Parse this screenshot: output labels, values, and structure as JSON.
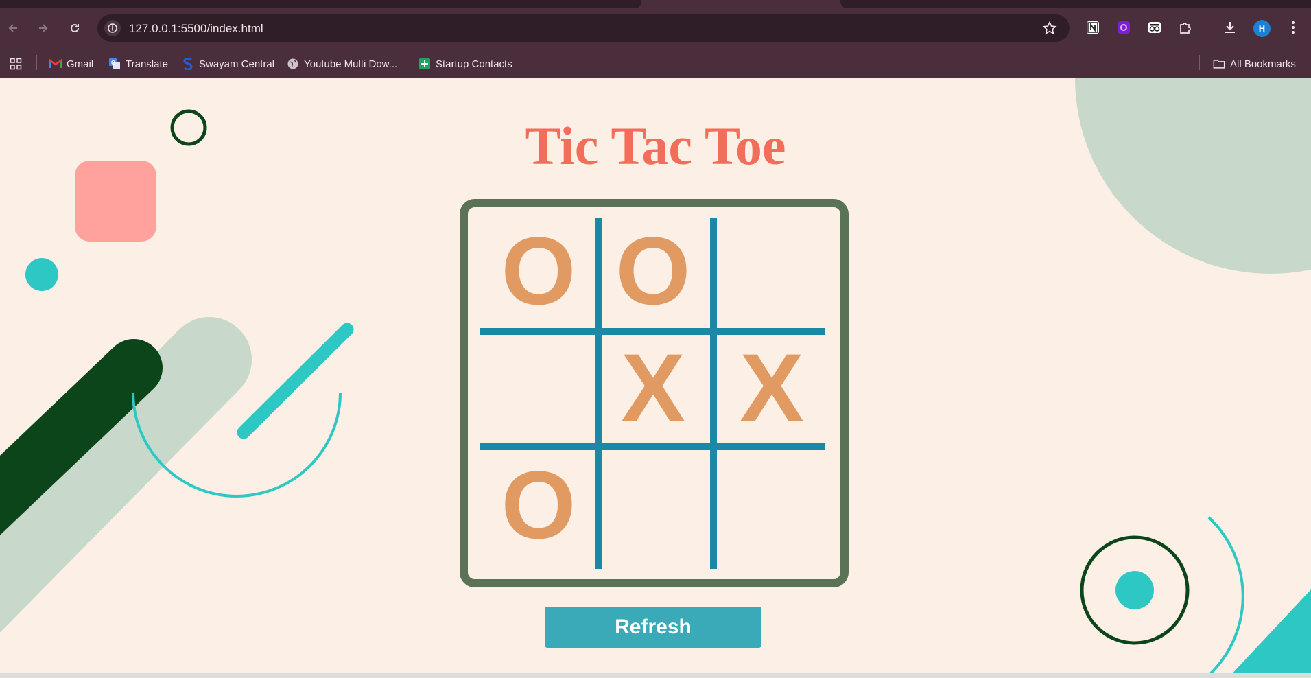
{
  "browser": {
    "url": "127.0.0.1:5500/index.html",
    "profile_initial": "H",
    "bookmarks": [
      {
        "label": "Gmail",
        "icon": "gmail-icon"
      },
      {
        "label": "Translate",
        "icon": "translate-icon"
      },
      {
        "label": "Swayam Central",
        "icon": "swayam-icon"
      },
      {
        "label": "Youtube Multi Dow...",
        "icon": "globe-icon"
      },
      {
        "label": "Startup Contacts",
        "icon": "sheets-icon"
      }
    ],
    "all_bookmarks_label": "All Bookmarks"
  },
  "game": {
    "title": "Tic Tac Toe",
    "cells": [
      "O",
      "O",
      "",
      "",
      "X",
      "X",
      "O",
      "",
      ""
    ],
    "refresh_label": "Refresh"
  },
  "colors": {
    "background": "#fcefe5",
    "title": "#f26e5b",
    "board_border": "#5a7256",
    "grid_lines": "#1b88a7",
    "marks": "#e09a62",
    "button": "#3aa9b8",
    "teal_accent": "#2ec8c4",
    "dark_green": "#0b4519",
    "sage": "#c8d8cb",
    "pink": "#ffa19c"
  }
}
